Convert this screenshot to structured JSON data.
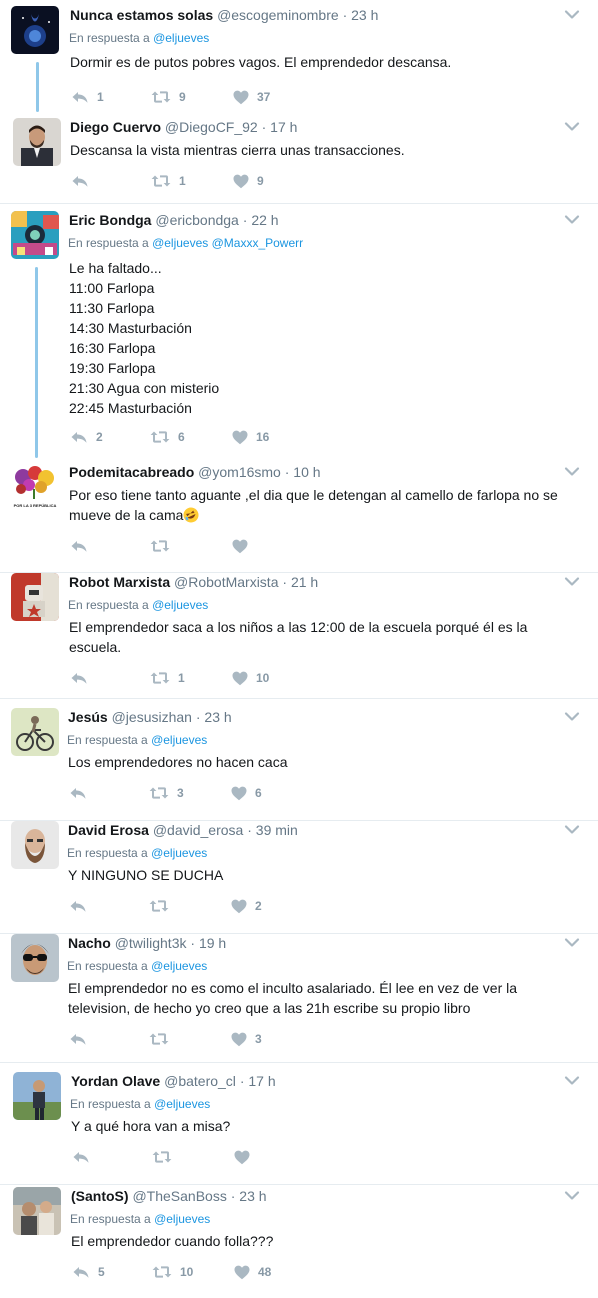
{
  "reply_prefix": "En respuesta a",
  "colors": {
    "link": "#1b95e0",
    "muted": "#657786",
    "icon": "#aab8c2",
    "thread": "#8fc7e9",
    "divider": "#e6ecf0"
  },
  "icons": {
    "reply": "reply-icon",
    "retweet": "retweet-icon",
    "like": "heart-icon",
    "more": "chevron-down-icon"
  },
  "tweets": [
    {
      "name": "Nunca estamos solas",
      "handle": "@escogeminombre",
      "time": "23 h",
      "reply_to": "@eljueves",
      "lines": [
        "Dormir es de putos pobres vagos. El emprendedor descansa."
      ],
      "replies": "1",
      "retweets": "9",
      "likes": "37",
      "avatar": "night-sky-avatar"
    },
    {
      "name": "Diego Cuervo",
      "handle": "@DiegoCF_92",
      "time": "17 h",
      "reply_to": "",
      "lines": [
        "Descansa la vista mientras cierra unas transacciones."
      ],
      "replies": "",
      "retweets": "1",
      "likes": "9",
      "avatar": "man-in-suit-avatar"
    },
    {
      "name": "Eric Bondga",
      "handle": "@ericbondga",
      "time": "22 h",
      "reply_to": "@eljueves @Maxxx_Powerr",
      "lines": [
        "Le ha faltado...",
        "11:00 Farlopa",
        "11:30 Farlopa",
        "14:30 Masturbación",
        "16:30 Farlopa",
        "19:30 Farlopa",
        "21:30 Agua con misterio",
        "22:45 Masturbación"
      ],
      "replies": "2",
      "retweets": "6",
      "likes": "16",
      "avatar": "colorful-illustration-avatar"
    },
    {
      "name": "Podemitacabreado",
      "handle": "@yom16smo",
      "time": "10 h",
      "reply_to": "",
      "lines": [
        "Por eso tiene tanto aguante ,el dia que le detengan al camello de farlopa no se",
        "mueve de la cama"
      ],
      "emoji": "rolling-on-floor-laughing-emoji",
      "avatar_caption": "POR LA 3 REPÚBLICA",
      "replies": "",
      "retweets": "",
      "likes": "",
      "avatar": "flowers-avatar"
    },
    {
      "name": "Robot Marxista",
      "handle": "@RobotMarxista",
      "time": "21 h",
      "reply_to": "@eljueves",
      "lines": [
        "El emprendedor saca a los niños a las 12:00 de la escuela porqué él es la",
        "escuela."
      ],
      "replies": "",
      "retweets": "1",
      "likes": "10",
      "avatar": "robot-avatar"
    },
    {
      "name": "Jesús",
      "handle": "@jesusizhan",
      "time": "23 h",
      "reply_to": "@eljueves",
      "lines": [
        "Los emprendedores no hacen caca"
      ],
      "replies": "",
      "retweets": "3",
      "likes": "6",
      "avatar": "cyclist-avatar"
    },
    {
      "name": "David Erosa",
      "handle": "@david_erosa",
      "time": "39 min",
      "reply_to": "@eljueves",
      "lines": [
        "Y NINGUNO SE DUCHA"
      ],
      "replies": "",
      "retweets": "",
      "likes": "2",
      "avatar": "bearded-man-avatar"
    },
    {
      "name": "Nacho",
      "handle": "@twilight3k",
      "time": "19 h",
      "reply_to": "@eljueves",
      "lines": [
        "El emprendedor no es como el inculto asalariado. Él lee en vez de ver la",
        "television, de hecho yo creo que a las 21h escribe su propio libro"
      ],
      "replies": "",
      "retweets": "",
      "likes": "3",
      "avatar": "sunglasses-man-avatar"
    },
    {
      "name": "Yordan Olave",
      "handle": "@batero_cl",
      "time": "17 h",
      "reply_to": "@eljueves",
      "lines": [
        "Y a qué hora van a misa?"
      ],
      "replies": "",
      "retweets": "",
      "likes": "",
      "avatar": "man-outdoors-avatar"
    },
    {
      "name": "(SantoS)",
      "handle": "@TheSanBoss",
      "time": "23 h",
      "reply_to": "@eljueves",
      "lines": [
        "El emprendedor cuando folla???"
      ],
      "replies": "5",
      "retweets": "10",
      "likes": "48",
      "avatar": "people-photo-avatar"
    }
  ]
}
